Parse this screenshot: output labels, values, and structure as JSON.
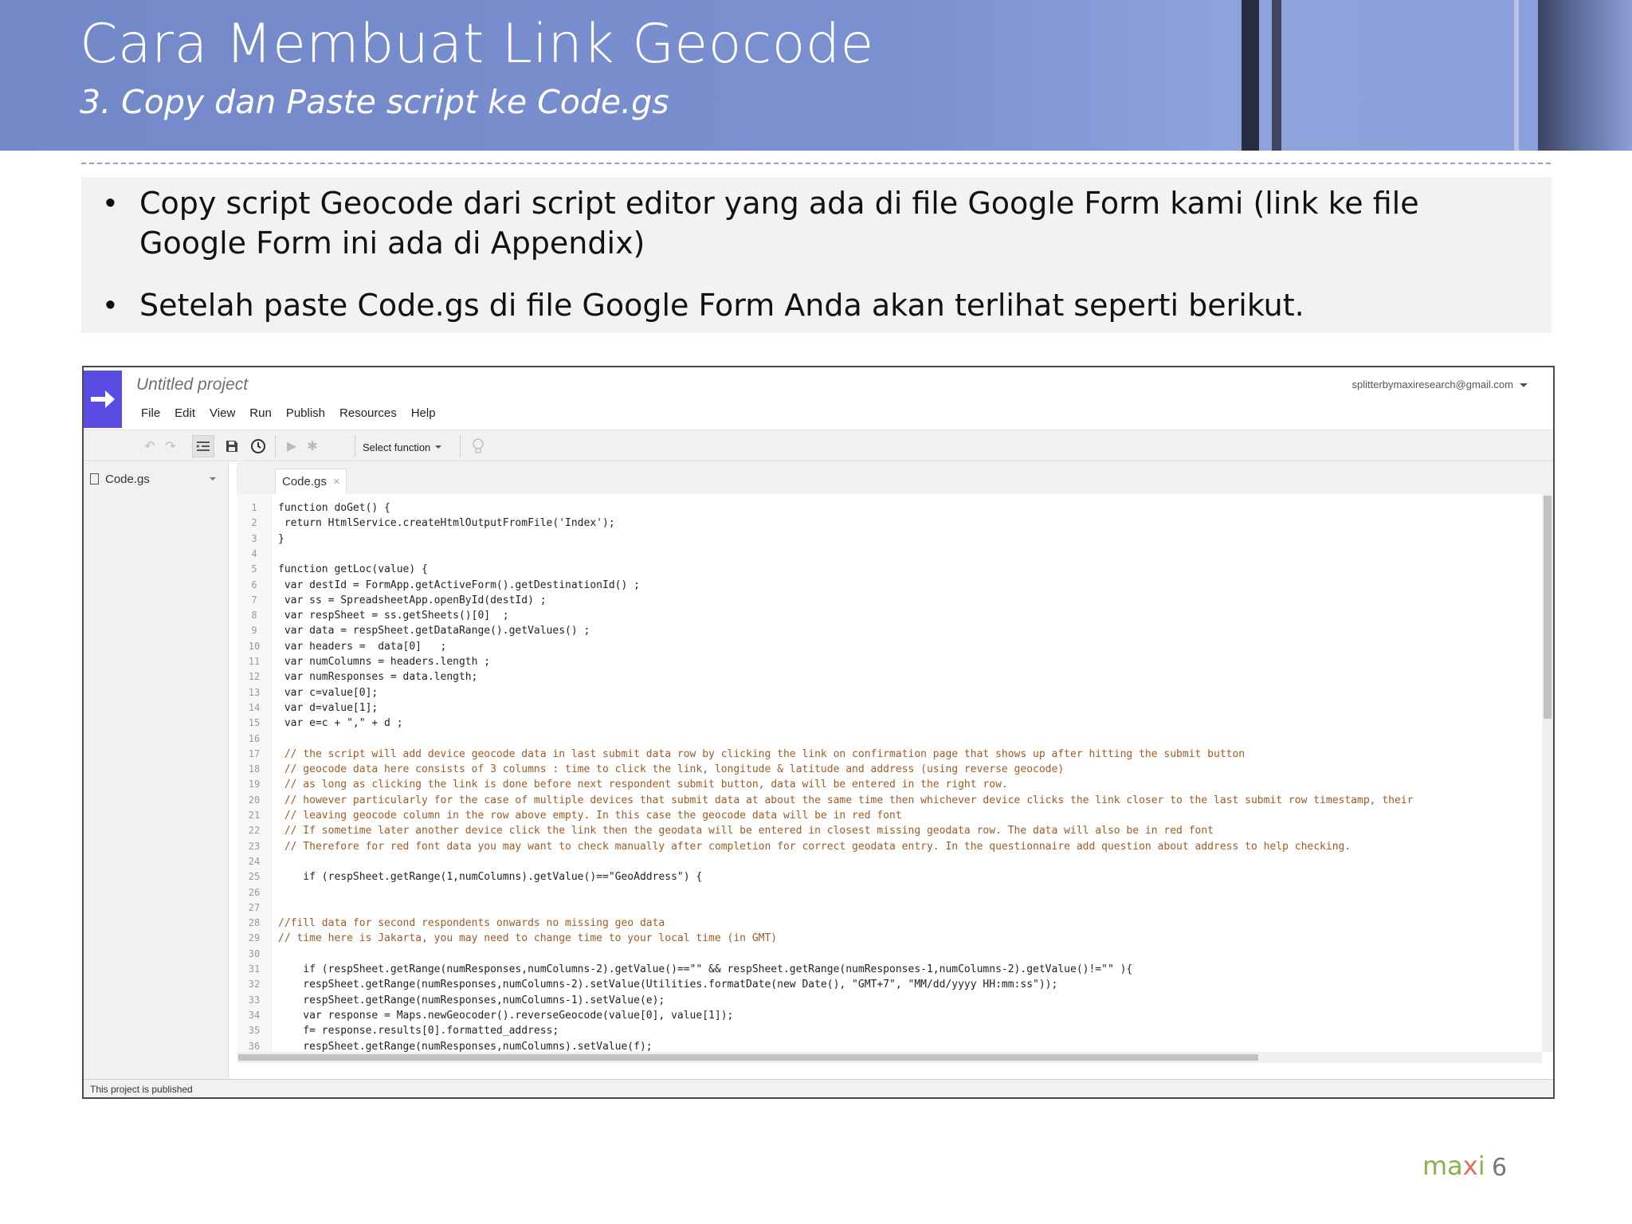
{
  "slide": {
    "title": "Cara Membuat Link Geocode",
    "subtitle": "3. Copy dan Paste script ke Code.gs",
    "bullets": [
      "Copy script Geocode dari script editor yang ada di file Google Form kami (link ke file Google Form ini ada di Appendix)",
      "Setelah paste Code.gs di file Google Form Anda akan terlihat seperti  berikut."
    ],
    "bullet_symbol": "•",
    "footer": {
      "brand_part1": "ma",
      "brand_part2": "x",
      "brand_part3": "i",
      "page_number": "6"
    }
  },
  "editor": {
    "project_name": "Untitled project",
    "account": "splitterbymaxiresearch@gmail.com",
    "menu": [
      "File",
      "Edit",
      "View",
      "Run",
      "Publish",
      "Resources",
      "Help"
    ],
    "toolbar": {
      "select_function": "Select function"
    },
    "sidebar_file": "Code.gs",
    "tab_label": "Code.gs",
    "status": "This project is published",
    "accent_color": "#5a4be3",
    "code_lines": [
      {
        "n": "1",
        "text": "function doGet() {"
      },
      {
        "n": "2",
        "text": " return HtmlService.createHtmlOutputFromFile('Index');"
      },
      {
        "n": "3",
        "text": "}"
      },
      {
        "n": "4",
        "text": ""
      },
      {
        "n": "5",
        "text": "function getLoc(value) {"
      },
      {
        "n": "6",
        "text": " var destId = FormApp.getActiveForm().getDestinationId() ;"
      },
      {
        "n": "7",
        "text": " var ss = SpreadsheetApp.openById(destId) ;"
      },
      {
        "n": "8",
        "text": " var respSheet = ss.getSheets()[0]  ;"
      },
      {
        "n": "9",
        "text": " var data = respSheet.getDataRange().getValues() ;"
      },
      {
        "n": "10",
        "text": " var headers =  data[0]   ;"
      },
      {
        "n": "11",
        "text": " var numColumns = headers.length ;"
      },
      {
        "n": "12",
        "text": " var numResponses = data.length;"
      },
      {
        "n": "13",
        "text": " var c=value[0];"
      },
      {
        "n": "14",
        "text": " var d=value[1];"
      },
      {
        "n": "15",
        "text": " var e=c + \",\" + d ;"
      },
      {
        "n": "16",
        "text": ""
      },
      {
        "n": "17",
        "text": " // the script will add device geocode data in last submit data row by clicking the link on confirmation page that shows up after hitting the submit button"
      },
      {
        "n": "18",
        "text": " // geocode data here consists of 3 columns : time to click the link, longitude & latitude and address (using reverse geocode)"
      },
      {
        "n": "19",
        "text": " // as long as clicking the link is done before next respondent submit button, data will be entered in the right row."
      },
      {
        "n": "20",
        "text": " // however particularly for the case of multiple devices that submit data at about the same time then whichever device clicks the link closer to the last submit row timestamp, their"
      },
      {
        "n": "21",
        "text": " // leaving geocode column in the row above empty. In this case the geocode data will be in red font"
      },
      {
        "n": "22",
        "text": " // If sometime later another device click the link then the geodata will be entered in closest missing geodata row. The data will also be in red font"
      },
      {
        "n": "23",
        "text": " // Therefore for red font data you may want to check manually after completion for correct geodata entry. In the questionnaire add question about address to help checking."
      },
      {
        "n": "24",
        "text": ""
      },
      {
        "n": "25",
        "text": "    if (respSheet.getRange(1,numColumns).getValue()==\"GeoAddress\") {"
      },
      {
        "n": "26",
        "text": ""
      },
      {
        "n": "27",
        "text": ""
      },
      {
        "n": "28",
        "text": "//fill data for second respondents onwards no missing geo data"
      },
      {
        "n": "29",
        "text": "// time here is Jakarta, you may need to change time to your local time (in GMT)"
      },
      {
        "n": "30",
        "text": ""
      },
      {
        "n": "31",
        "text": "    if (respSheet.getRange(numResponses,numColumns-2).getValue()==\"\" && respSheet.getRange(numResponses-1,numColumns-2).getValue()!=\"\" ){"
      },
      {
        "n": "32",
        "text": "    respSheet.getRange(numResponses,numColumns-2).setValue(Utilities.formatDate(new Date(), \"GMT+7\", \"MM/dd/yyyy HH:mm:ss\"));"
      },
      {
        "n": "33",
        "text": "    respSheet.getRange(numResponses,numColumns-1).setValue(e);"
      },
      {
        "n": "34",
        "text": "    var response = Maps.newGeocoder().reverseGeocode(value[0], value[1]);"
      },
      {
        "n": "35",
        "text": "    f= response.results[0].formatted_address;"
      },
      {
        "n": "36",
        "text": "    respSheet.getRange(numResponses,numColumns).setValue(f);"
      }
    ]
  }
}
